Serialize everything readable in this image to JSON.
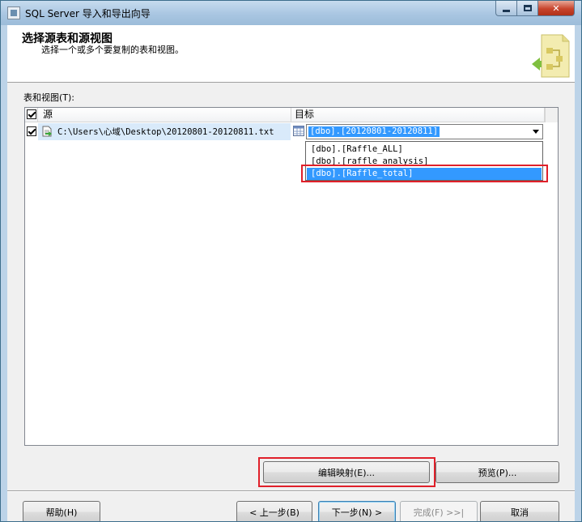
{
  "window": {
    "title": "SQL Server 导入和导出向导"
  },
  "header": {
    "title": "选择源表和源视图",
    "subtitle": "选择一个或多个要复制的表和视图。"
  },
  "section_label": "表和视图(T):",
  "grid": {
    "columns": {
      "source": "源",
      "target": "目标"
    },
    "rows": [
      {
        "checked": true,
        "source": "C:\\Users\\心域\\Desktop\\20120801-20120811.txt",
        "target": "[dbo].[20120801-20120811]"
      }
    ]
  },
  "dropdown": {
    "options": [
      "[dbo].[Raffle_ALL]",
      "[dbo].[raffle_analysis]",
      "[dbo].[Raffle_total]"
    ],
    "highlighted_index": 2
  },
  "buttons": {
    "edit_mapping": "编辑映射(E)...",
    "preview": "预览(P)...",
    "help": "帮助(H)",
    "back": "< 上一步(B)",
    "next": "下一步(N) >",
    "finish": "完成(F) >>|",
    "cancel": "取消"
  },
  "colors": {
    "highlight_red": "#e0202a",
    "selection_blue": "#3399ff"
  }
}
